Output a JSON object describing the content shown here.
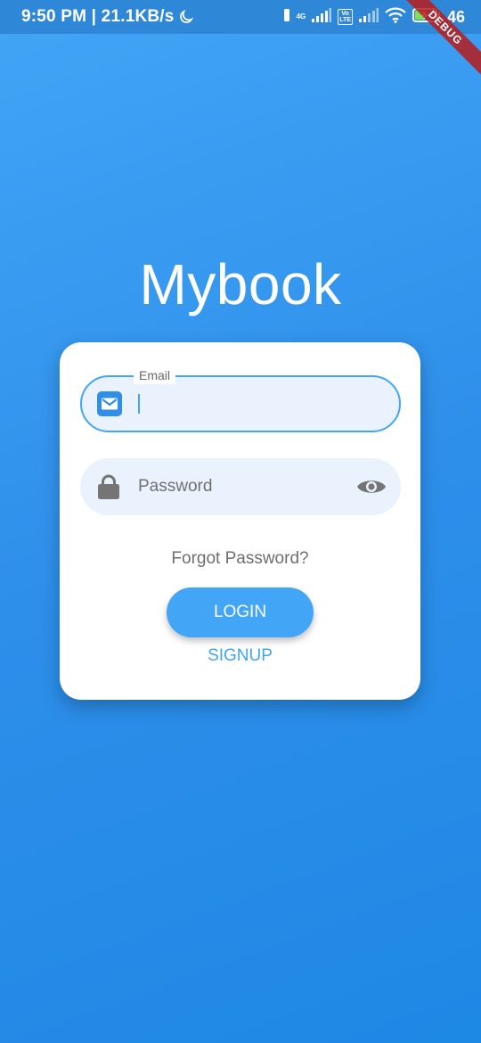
{
  "status_bar": {
    "time_speed": "9:50 PM | 21.1KB/s",
    "network_label": "4G",
    "volte_label_top": "Vo",
    "volte_label_bottom": "LTE",
    "battery_level": "46"
  },
  "debug_banner": "DEBUG",
  "app_title": "Mybook",
  "login_form": {
    "email": {
      "label": "Email",
      "value": "",
      "icon": "email-icon"
    },
    "password": {
      "placeholder": "Password",
      "value": "",
      "icon": "lock-icon",
      "toggle_icon": "eye-icon"
    },
    "forgot_password": "Forgot Password?",
    "login_label": "LOGIN",
    "signup_label": "SIGNUP"
  },
  "colors": {
    "primary": "#42A5F5",
    "background_top": "#42A5F5",
    "background_bottom": "#1E88E5",
    "field_fill": "#EAF3FD",
    "card": "#FFFFFF"
  }
}
